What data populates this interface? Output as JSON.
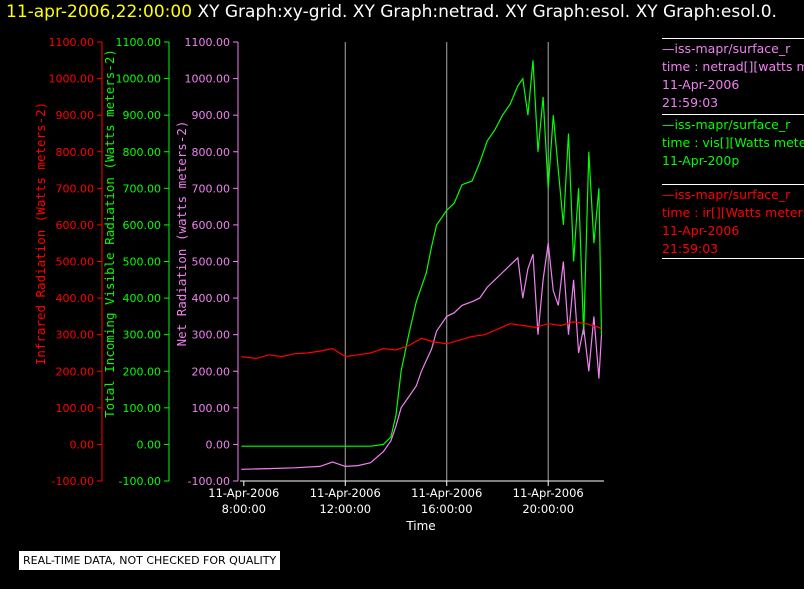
{
  "header": {
    "timestamp": "11-apr-2006,22:00:00",
    "titles": "XY Graph:xy-grid.  XY Graph:netrad.  XY Graph:esol.  XY Graph:esol.0."
  },
  "legend": [
    {
      "source": "—iss-mapr/surface_r",
      "field": "time : netrad[][watts me",
      "date": "11-Apr-2006",
      "time": "21:59:03",
      "color": "#ee82ee"
    },
    {
      "source": "—iss-mapr/surface_r",
      "field": "time : vis[][Watts mete",
      "date": "11-Apr-200p",
      "time": "",
      "color": "#00ff00"
    },
    {
      "source": "—iss-mapr/surface_r",
      "field": "time : ir[][Watts meters",
      "date": "11-Apr-2006",
      "time": "21:59:03",
      "color": "#ff0000"
    }
  ],
  "quality_note": "REAL-TIME DATA, NOT CHECKED FOR QUALITY",
  "chart_data": {
    "type": "line",
    "xlabel": "Time",
    "x_ticks": [
      {
        "date": "11-Apr-2006",
        "time": "8:00:00",
        "hour": 8
      },
      {
        "date": "11-Apr-2006",
        "time": "12:00:00",
        "hour": 12
      },
      {
        "date": "11-Apr-2006",
        "time": "16:00:00",
        "hour": 16
      },
      {
        "date": "11-Apr-2006",
        "time": "20:00:00",
        "hour": 20
      }
    ],
    "xlim": [
      7.85,
      22.2
    ],
    "ylim": [
      -100,
      1100
    ],
    "y_ticks": [
      "-100.00",
      "0.00",
      "100.00",
      "200.00",
      "300.00",
      "400.00",
      "500.00",
      "600.00",
      "700.00",
      "800.00",
      "900.00",
      "1000.00",
      "1100.00"
    ],
    "y_tick_values": [
      -100,
      0,
      100,
      200,
      300,
      400,
      500,
      600,
      700,
      800,
      900,
      1000,
      1100
    ],
    "axes": [
      {
        "label": "Infrared Radiation (Watts meters-2)",
        "color": "#ff0000"
      },
      {
        "label": "Total Incoming Visible Radiation (Watts meters-2)",
        "color": "#00ff00"
      },
      {
        "label": "Net Radiation (watts meters-2)",
        "color": "#ee82ee"
      }
    ],
    "series": [
      {
        "name": "time : vis[][Watts mete",
        "color": "#00ff00",
        "x": [
          7.9,
          9,
          10,
          11,
          12,
          13,
          13.5,
          13.8,
          14,
          14.2,
          14.5,
          14.8,
          15,
          15.2,
          15.4,
          15.6,
          15.8,
          16,
          16.3,
          16.6,
          17,
          17.3,
          17.6,
          17.9,
          18.2,
          18.5,
          18.8,
          19,
          19.2,
          19.4,
          19.6,
          19.8,
          20,
          20.2,
          20.4,
          20.6,
          20.8,
          21,
          21.2,
          21.4,
          21.6,
          21.8,
          22,
          22.1
        ],
        "y": [
          -5,
          -5,
          -5,
          -5,
          -5,
          -5,
          0,
          20,
          80,
          200,
          300,
          390,
          430,
          470,
          540,
          600,
          620,
          640,
          660,
          710,
          720,
          770,
          830,
          860,
          900,
          930,
          980,
          1000,
          900,
          1050,
          800,
          950,
          700,
          900,
          750,
          600,
          850,
          500,
          700,
          300,
          800,
          550,
          700,
          300
        ]
      },
      {
        "name": "time : netrad[][watts me",
        "color": "#ee82ee",
        "x": [
          7.9,
          9,
          10,
          11,
          11.5,
          12,
          12.5,
          13,
          13.5,
          13.8,
          14,
          14.2,
          14.5,
          14.8,
          15,
          15.2,
          15.4,
          15.6,
          15.8,
          16,
          16.3,
          16.6,
          17,
          17.3,
          17.6,
          17.9,
          18.2,
          18.5,
          18.8,
          19,
          19.2,
          19.4,
          19.6,
          19.8,
          20,
          20.2,
          20.4,
          20.6,
          20.8,
          21,
          21.2,
          21.4,
          21.6,
          21.8,
          22,
          22.1
        ],
        "y": [
          -68,
          -66,
          -64,
          -60,
          -48,
          -60,
          -58,
          -50,
          -20,
          10,
          50,
          100,
          130,
          160,
          200,
          230,
          260,
          310,
          330,
          350,
          360,
          380,
          390,
          400,
          430,
          450,
          470,
          490,
          510,
          400,
          480,
          520,
          300,
          450,
          550,
          420,
          380,
          500,
          300,
          450,
          250,
          320,
          200,
          350,
          180,
          300
        ]
      },
      {
        "name": "time : ir[][Watts meters",
        "color": "#ff0000",
        "x": [
          7.9,
          8.5,
          9,
          9.5,
          10,
          10.5,
          11,
          11.5,
          12,
          12.5,
          13,
          13.5,
          14,
          14.5,
          15,
          15.5,
          16,
          16.5,
          17,
          17.5,
          18,
          18.5,
          19,
          19.5,
          20,
          20.5,
          21,
          21.5,
          22,
          22.1
        ],
        "y": [
          240,
          235,
          245,
          240,
          248,
          250,
          255,
          262,
          240,
          245,
          250,
          262,
          258,
          270,
          290,
          280,
          275,
          285,
          295,
          300,
          315,
          330,
          325,
          320,
          330,
          325,
          335,
          330,
          320,
          315
        ]
      }
    ]
  }
}
